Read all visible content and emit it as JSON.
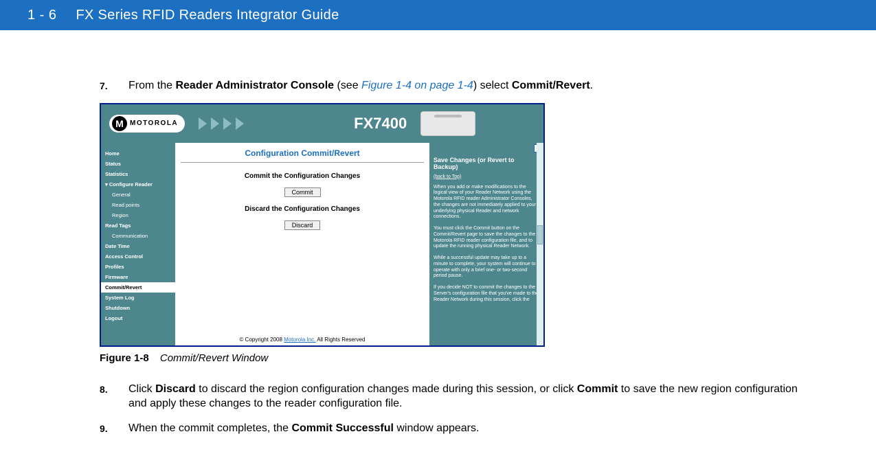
{
  "header": {
    "page": "1 - 6",
    "title": "FX Series RFID Readers Integrator Guide"
  },
  "steps": {
    "s7": {
      "num": "7.",
      "pre": "From the ",
      "b1": "Reader Administrator Console",
      "mid": " (see ",
      "link": "Figure 1-4 on page 1-4",
      "post1": ") select ",
      "b2": "Commit/Revert",
      "end": "."
    },
    "s8": {
      "num": "8.",
      "pre": "Click ",
      "b1": "Discard",
      "mid": " to discard the region configuration changes made during this session, or click ",
      "b2": "Commit",
      "post": " to save the new region configuration and apply these changes to the reader configuration file."
    },
    "s9": {
      "num": "9.",
      "pre": "When the commit completes, the ",
      "b1": "Commit Successful",
      "post": " window appears."
    }
  },
  "figure": {
    "label": "Figure 1-8",
    "title": "Commit/Revert Window"
  },
  "shot": {
    "logo_text": "MOTOROLA",
    "model": "FX7400",
    "sidebar": {
      "home": "Home",
      "status": "Status",
      "statistics": "Statistics",
      "configure": "Configure Reader",
      "general": "General",
      "readpoints": "Read points",
      "region": "Region",
      "readtags": "Read Tags",
      "communication": "Communication",
      "datetime": "Date Time",
      "access": "Access Control",
      "profiles": "Profiles",
      "firmware": "Firmware",
      "commitrevert": "Commit/Revert",
      "syslog": "System Log",
      "shutdown": "Shutdown",
      "logout": "Logout"
    },
    "main": {
      "title": "Configuration Commit/Revert",
      "commit_h": "Commit the Configuration Changes",
      "commit_btn": "Commit",
      "discard_h": "Discard the Configuration Changes",
      "discard_btn": "Discard",
      "copyright_pre": "© Copyright 2008 ",
      "copyright_link": "Motorola Inc.",
      "copyright_post": " All Rights Reserved"
    },
    "help": {
      "icon": "?",
      "title": "Save Changes (or Revert to Backup)",
      "back": "(back to Top)",
      "p1": "When you add or make modifications to the logical view of your Reader Network using the Motorola RFID reader Administrator Consoles, the changes are not immediately applied to your underlying physical Reader and network connections.",
      "p2": "You must click the Commit button on the Commit/Revert page to save the changes to the Motorola RFID reader configuration file, and to update the running physical Reader Network.",
      "p3": "While a successful update may take up to a minute to complete, your system will continue to operate with only a brief one- or two-second period pause.",
      "p4": "If you decide NOT to commit the changes to the Server's configuration file that you've made to the Reader Network during this session, click the"
    }
  }
}
